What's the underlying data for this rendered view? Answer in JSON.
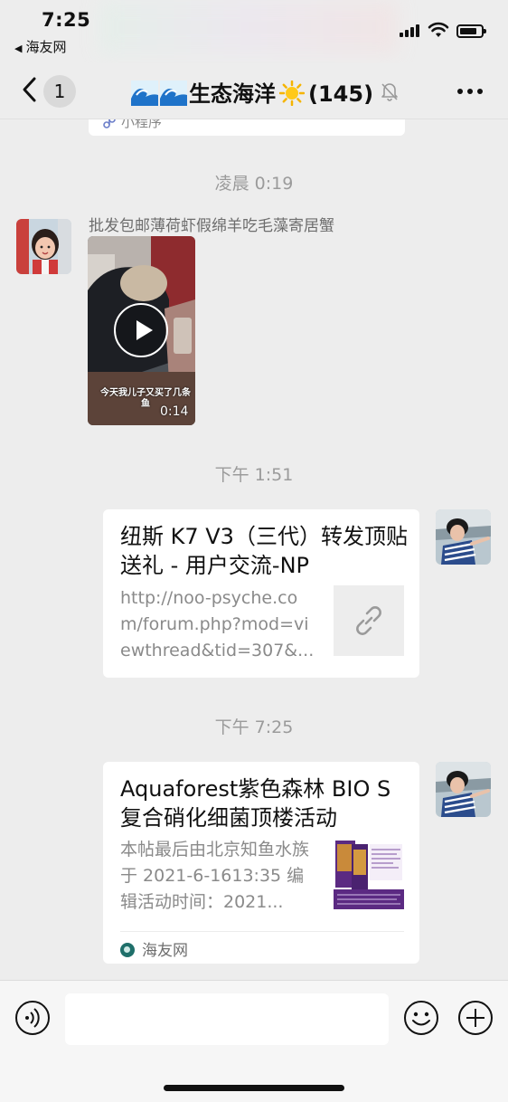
{
  "status_bar": {
    "time": "7:25",
    "back_app": "海友网",
    "back_arrow": "◀"
  },
  "nav": {
    "unread_count": "1",
    "title_text": "生态海洋",
    "member_count": "(145)",
    "icons": {
      "back": "chevron-left-icon",
      "waves": "wave-emoji-icon",
      "sun": "sun-emoji-icon",
      "mute": "bell-slash-icon",
      "more": "more-dots-icon"
    }
  },
  "chat": {
    "prev_card_label": "小程序",
    "messages": [
      {
        "type": "timestamp",
        "text": "凌晨 0:19"
      },
      {
        "type": "video",
        "sender_name": "批发包邮薄荷虾假绵羊吃毛藻寄居蟹",
        "caption": "今天我儿子又买了几条鱼",
        "duration": "0:14"
      },
      {
        "type": "timestamp",
        "text": "下午 1:51"
      },
      {
        "type": "link",
        "title": "纽斯 K7 V3（三代）转发顶贴送礼 - 用户交流-NP",
        "description": "http://noo-psyche.com/forum.php?mod=viewthread&tid=307&...",
        "thumb_icon": "link-icon"
      },
      {
        "type": "timestamp",
        "text": "下午 7:25"
      },
      {
        "type": "link",
        "title": "Aquaforest紫色森林 BIO S复合硝化细菌顶楼活动",
        "description": "本帖最后由北京知鱼水族于 2021-6-1613:35 编辑活动时间：2021...",
        "source": "海友网"
      }
    ]
  },
  "input_bar": {
    "icons": {
      "voice": "voice-icon",
      "emoji": "emoji-icon",
      "plus": "plus-icon"
    }
  },
  "colors": {
    "background": "#ededed",
    "bubble": "#ffffff",
    "timestamp": "#9b9b9b",
    "link_desc": "#8a8a8a"
  }
}
